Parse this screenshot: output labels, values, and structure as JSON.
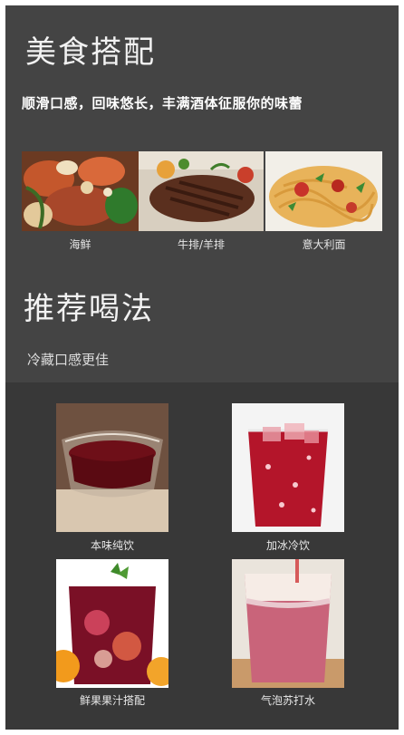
{
  "food_section": {
    "title": "美食搭配",
    "tagline": "顺滑口感，回味悠长，丰满酒体征服你的味蕾",
    "items": [
      {
        "label": "海鲜",
        "image": "seafood-photo"
      },
      {
        "label": "牛排/羊排",
        "image": "steak-photo"
      },
      {
        "label": "意大利面",
        "image": "spaghetti-photo"
      }
    ]
  },
  "drink_section": {
    "title": "推荐喝法",
    "subtitle": "冷藏口感更佳",
    "items": [
      {
        "label": "本味纯饮",
        "image": "neat-wine-glass-photo"
      },
      {
        "label": "加冰冷饮",
        "image": "iced-wine-glass-photo"
      },
      {
        "label": "鲜果果汁搭配",
        "image": "fruit-punch-photo"
      },
      {
        "label": "气泡苏打水",
        "image": "soda-float-photo"
      }
    ]
  }
}
